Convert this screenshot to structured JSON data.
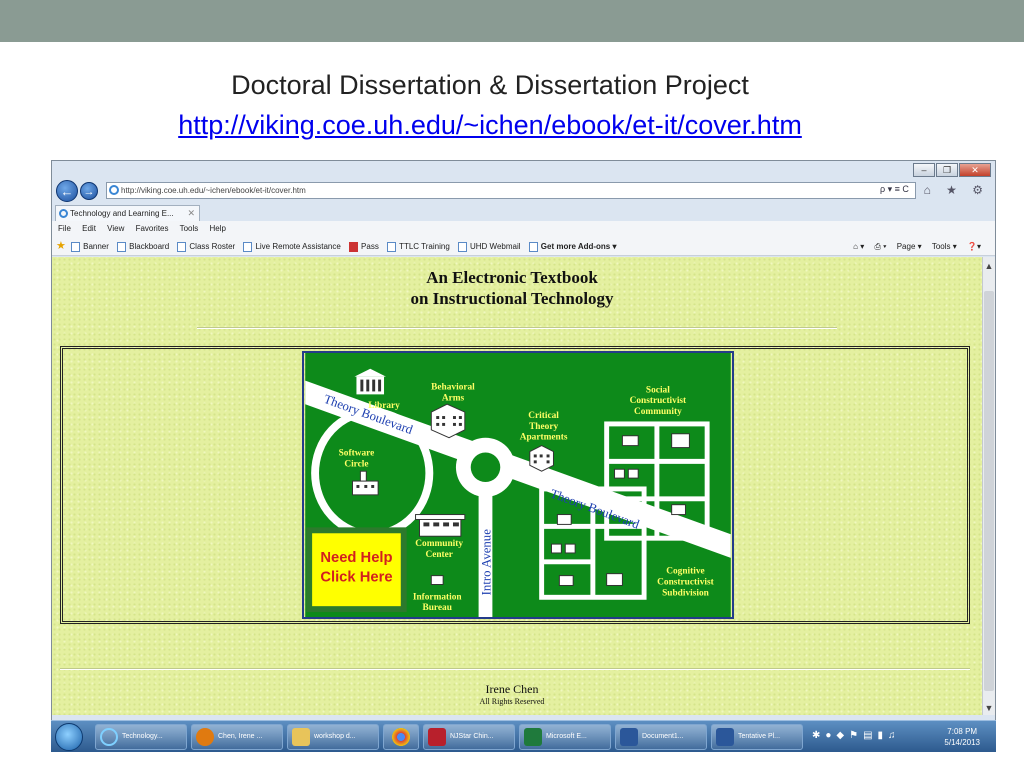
{
  "slide": {
    "title": "Doctoral Dissertation & Dissertation Project",
    "link": "http://viking.coe.uh.edu/~ichen/ebook/et-it/cover.htm"
  },
  "browser": {
    "address": "http://viking.coe.uh.edu/~ichen/ebook/et-it/cover.htm",
    "address_tools": "ρ ▾ ≡ C",
    "right_icons": "⌂ ★ ⚙",
    "tab_label": "Technology and Learning E...",
    "menu": [
      "File",
      "Edit",
      "View",
      "Favorites",
      "Tools",
      "Help"
    ],
    "favorites": [
      "Banner",
      "Blackboard",
      "Class Roster",
      "Live Remote Assistance",
      "Pass",
      "TTLC Training",
      "UHD Webmail"
    ],
    "get_addons": "Get more Add-ons ▾",
    "command_bar": [
      "Page ▾",
      "Tools ▾"
    ]
  },
  "page": {
    "heading_line1": "An Electronic Textbook",
    "heading_line2": "on Instructional Technology",
    "author": "Irene Chen",
    "rights": "All Rights Reserved"
  },
  "map": {
    "road_1": "Theory Boulevard",
    "road_2": "Theory Boulevard",
    "road_3": "Intro Avenue",
    "library": "Library",
    "behavioral": [
      "Behavioral",
      "Arms"
    ],
    "critical": [
      "Critical",
      "Theory",
      "Apartments"
    ],
    "social": [
      "Social",
      "Constructivist",
      "Community"
    ],
    "software": [
      "Software",
      "Circle"
    ],
    "community": [
      "Community",
      "Center"
    ],
    "information": [
      "Information",
      "Bureau"
    ],
    "cognitive": [
      "Cognitive",
      "Constructivist",
      "Subdivision"
    ],
    "help": [
      "Need Help",
      "Click Here"
    ]
  },
  "taskbar": {
    "items": [
      "Technology...",
      "Chen, Irene ...",
      "workshop d...",
      "",
      "NJStar Chin...",
      "Microsoft E...",
      "Document1...",
      "Tentative Pl..."
    ],
    "time": "7:08 PM",
    "date": "5/14/2013"
  }
}
